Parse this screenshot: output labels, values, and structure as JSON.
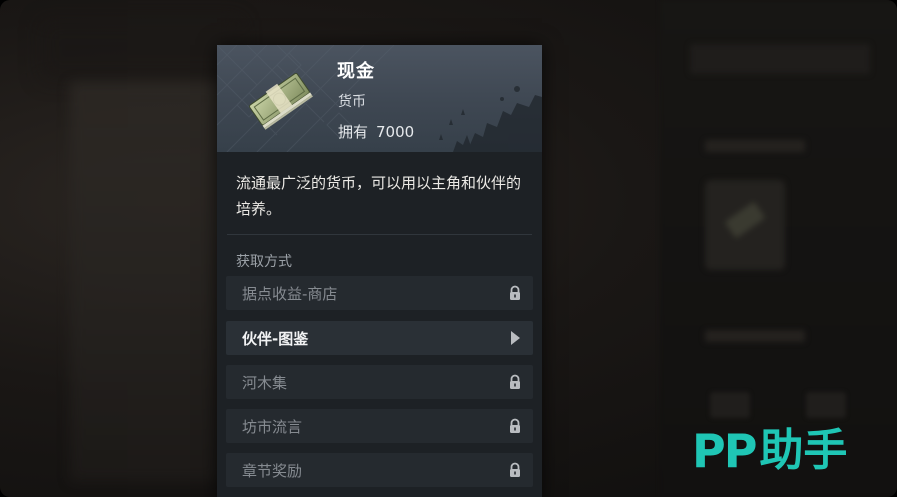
{
  "item": {
    "name": "现金",
    "type": "货币",
    "own_label": "拥有",
    "own_value": "7000",
    "icon": "cash-bundle-icon",
    "description": "流通最广泛的货币，可以用以主角和伙伴的培养。"
  },
  "acquisition": {
    "title": "获取方式",
    "sources": [
      {
        "label": "据点收益-商店",
        "state": "locked",
        "icon": "lock-icon"
      },
      {
        "label": "伙伴-图鉴",
        "state": "available",
        "icon": "arrow-right-icon"
      },
      {
        "label": "河木集",
        "state": "locked",
        "icon": "lock-icon"
      },
      {
        "label": "坊市流言",
        "state": "locked",
        "icon": "lock-icon"
      },
      {
        "label": "章节奖励",
        "state": "locked",
        "icon": "lock-icon"
      }
    ]
  },
  "watermark": {
    "latin": "PP",
    "chinese": "助手"
  },
  "colors": {
    "header_bg": "#434c57",
    "panel_bg": "#1d2125",
    "source_bg": "#252a2f",
    "watermark": "#1fc6b5"
  }
}
